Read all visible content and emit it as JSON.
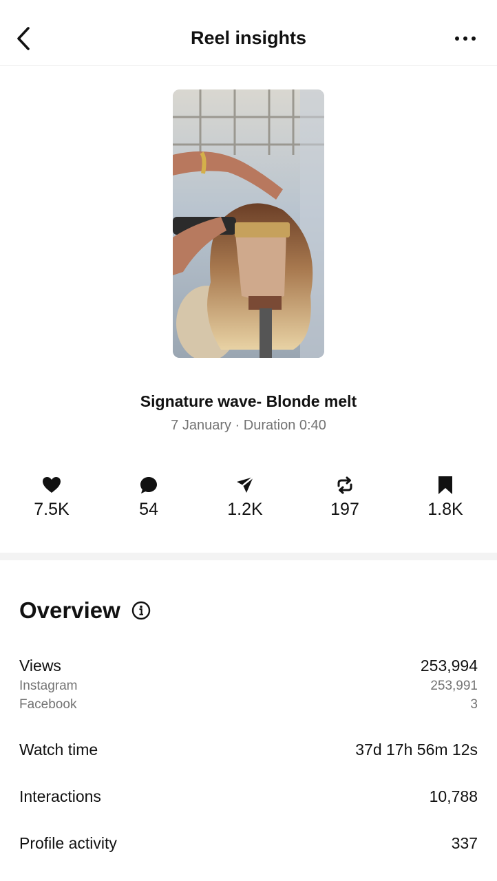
{
  "header": {
    "title": "Reel insights",
    "back_icon": "chevron-left-icon",
    "more_icon": "more-horizontal-icon"
  },
  "reel": {
    "thumbnail": "wig-on-mannequin-image",
    "title": "Signature wave- Blonde melt",
    "meta": "7 January · Duration 0:40"
  },
  "stats": [
    {
      "icon": "heart-icon",
      "value": "7.5K"
    },
    {
      "icon": "comment-icon",
      "value": "54"
    },
    {
      "icon": "share-icon",
      "value": "1.2K"
    },
    {
      "icon": "repost-icon",
      "value": "197"
    },
    {
      "icon": "bookmark-icon",
      "value": "1.8K"
    }
  ],
  "overview": {
    "title": "Overview",
    "info_icon": "info-icon",
    "views": {
      "label": "Views",
      "value": "253,994"
    },
    "instagram": {
      "label": "Instagram",
      "value": "253,991"
    },
    "facebook": {
      "label": "Facebook",
      "value": "3"
    },
    "watch_time": {
      "label": "Watch time",
      "value": "37d 17h 56m 12s"
    },
    "interactions": {
      "label": "Interactions",
      "value": "10,788"
    },
    "profile_activity": {
      "label": "Profile activity",
      "value": "337"
    }
  },
  "colors": {
    "text": "#111111",
    "secondary": "#737373",
    "divider": "#f3f3f3"
  }
}
